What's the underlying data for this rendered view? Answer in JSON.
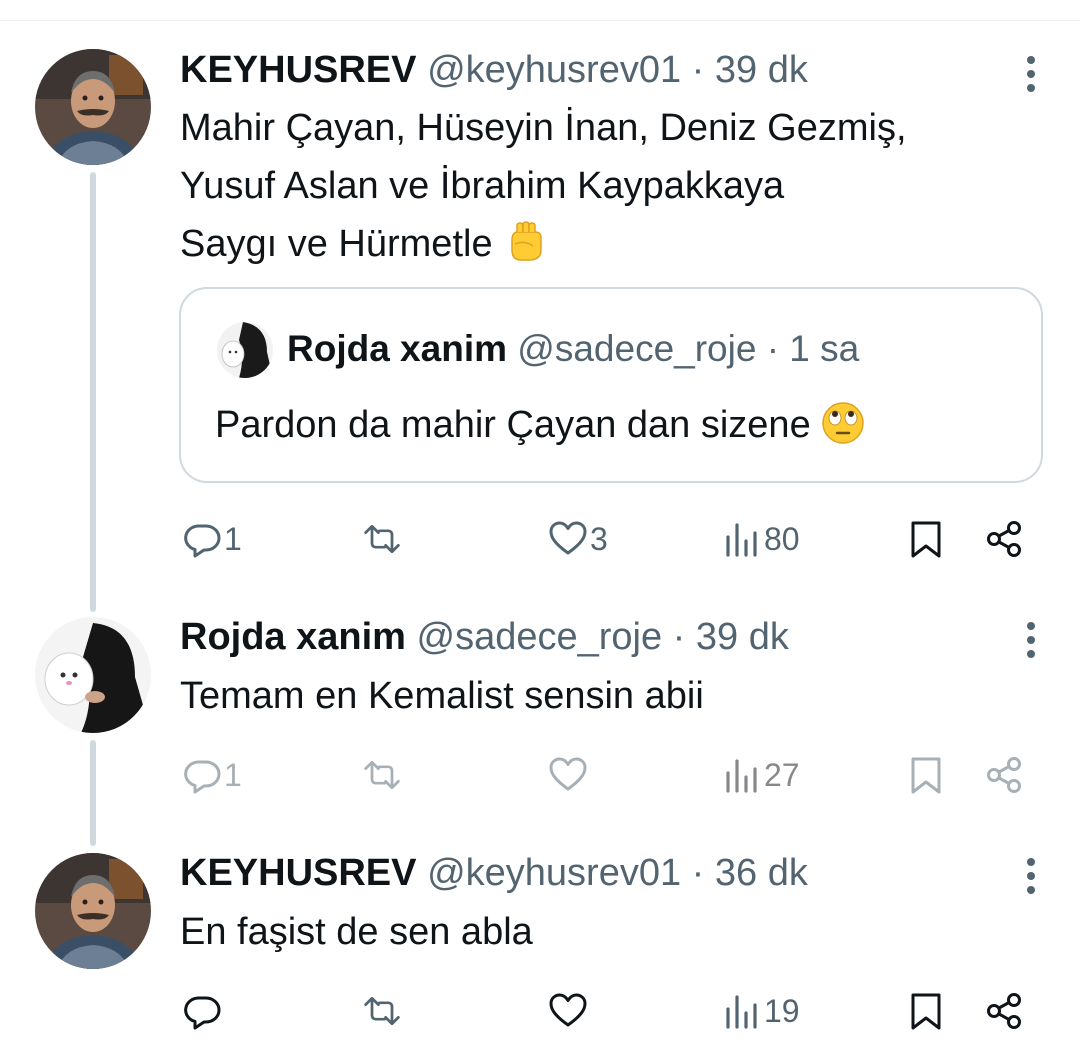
{
  "tweets": [
    {
      "name": "KEYHUSREV",
      "meta": "@keyhusrev01 · 39 dk",
      "lines": [
        "Mahir Çayan, Hüseyin İnan, Deniz Gezmiş,",
        "Yusuf Aslan ve İbrahim Kaypakkaya",
        "Saygı ve Hürmetle"
      ],
      "emoji": "raised-fist",
      "quote": {
        "name": "Rojda xanim",
        "meta": "@sadece_roje · 1 sa",
        "text": "Pardon da mahir Çayan dan sizene",
        "emoji": "face-with-rolling-eyes"
      },
      "actions": {
        "replies": "1",
        "retweets": "",
        "likes": "3",
        "views": "80"
      }
    },
    {
      "name": "Rojda xanim",
      "meta": "@sadece_roje · 39 dk",
      "lines": [
        "Temam en Kemalist sensin abii"
      ],
      "actions": {
        "replies": "1",
        "retweets": "",
        "likes": "",
        "views": "27"
      }
    },
    {
      "name": "KEYHUSREV",
      "meta": "@keyhusrev01 · 36 dk",
      "lines": [
        "En faşist de sen abla"
      ],
      "actions": {
        "replies": "",
        "retweets": "",
        "likes": "",
        "views": "19"
      }
    }
  ],
  "icons": {
    "reply": "reply-icon",
    "retweet": "retweet-icon",
    "like": "heart-icon",
    "views": "views-icon",
    "bookmark": "bookmark-icon",
    "share": "share-icon",
    "more": "more-icon"
  },
  "colors": {
    "text": "#0f1419",
    "muted": "#536471",
    "border": "#cfd9de"
  }
}
